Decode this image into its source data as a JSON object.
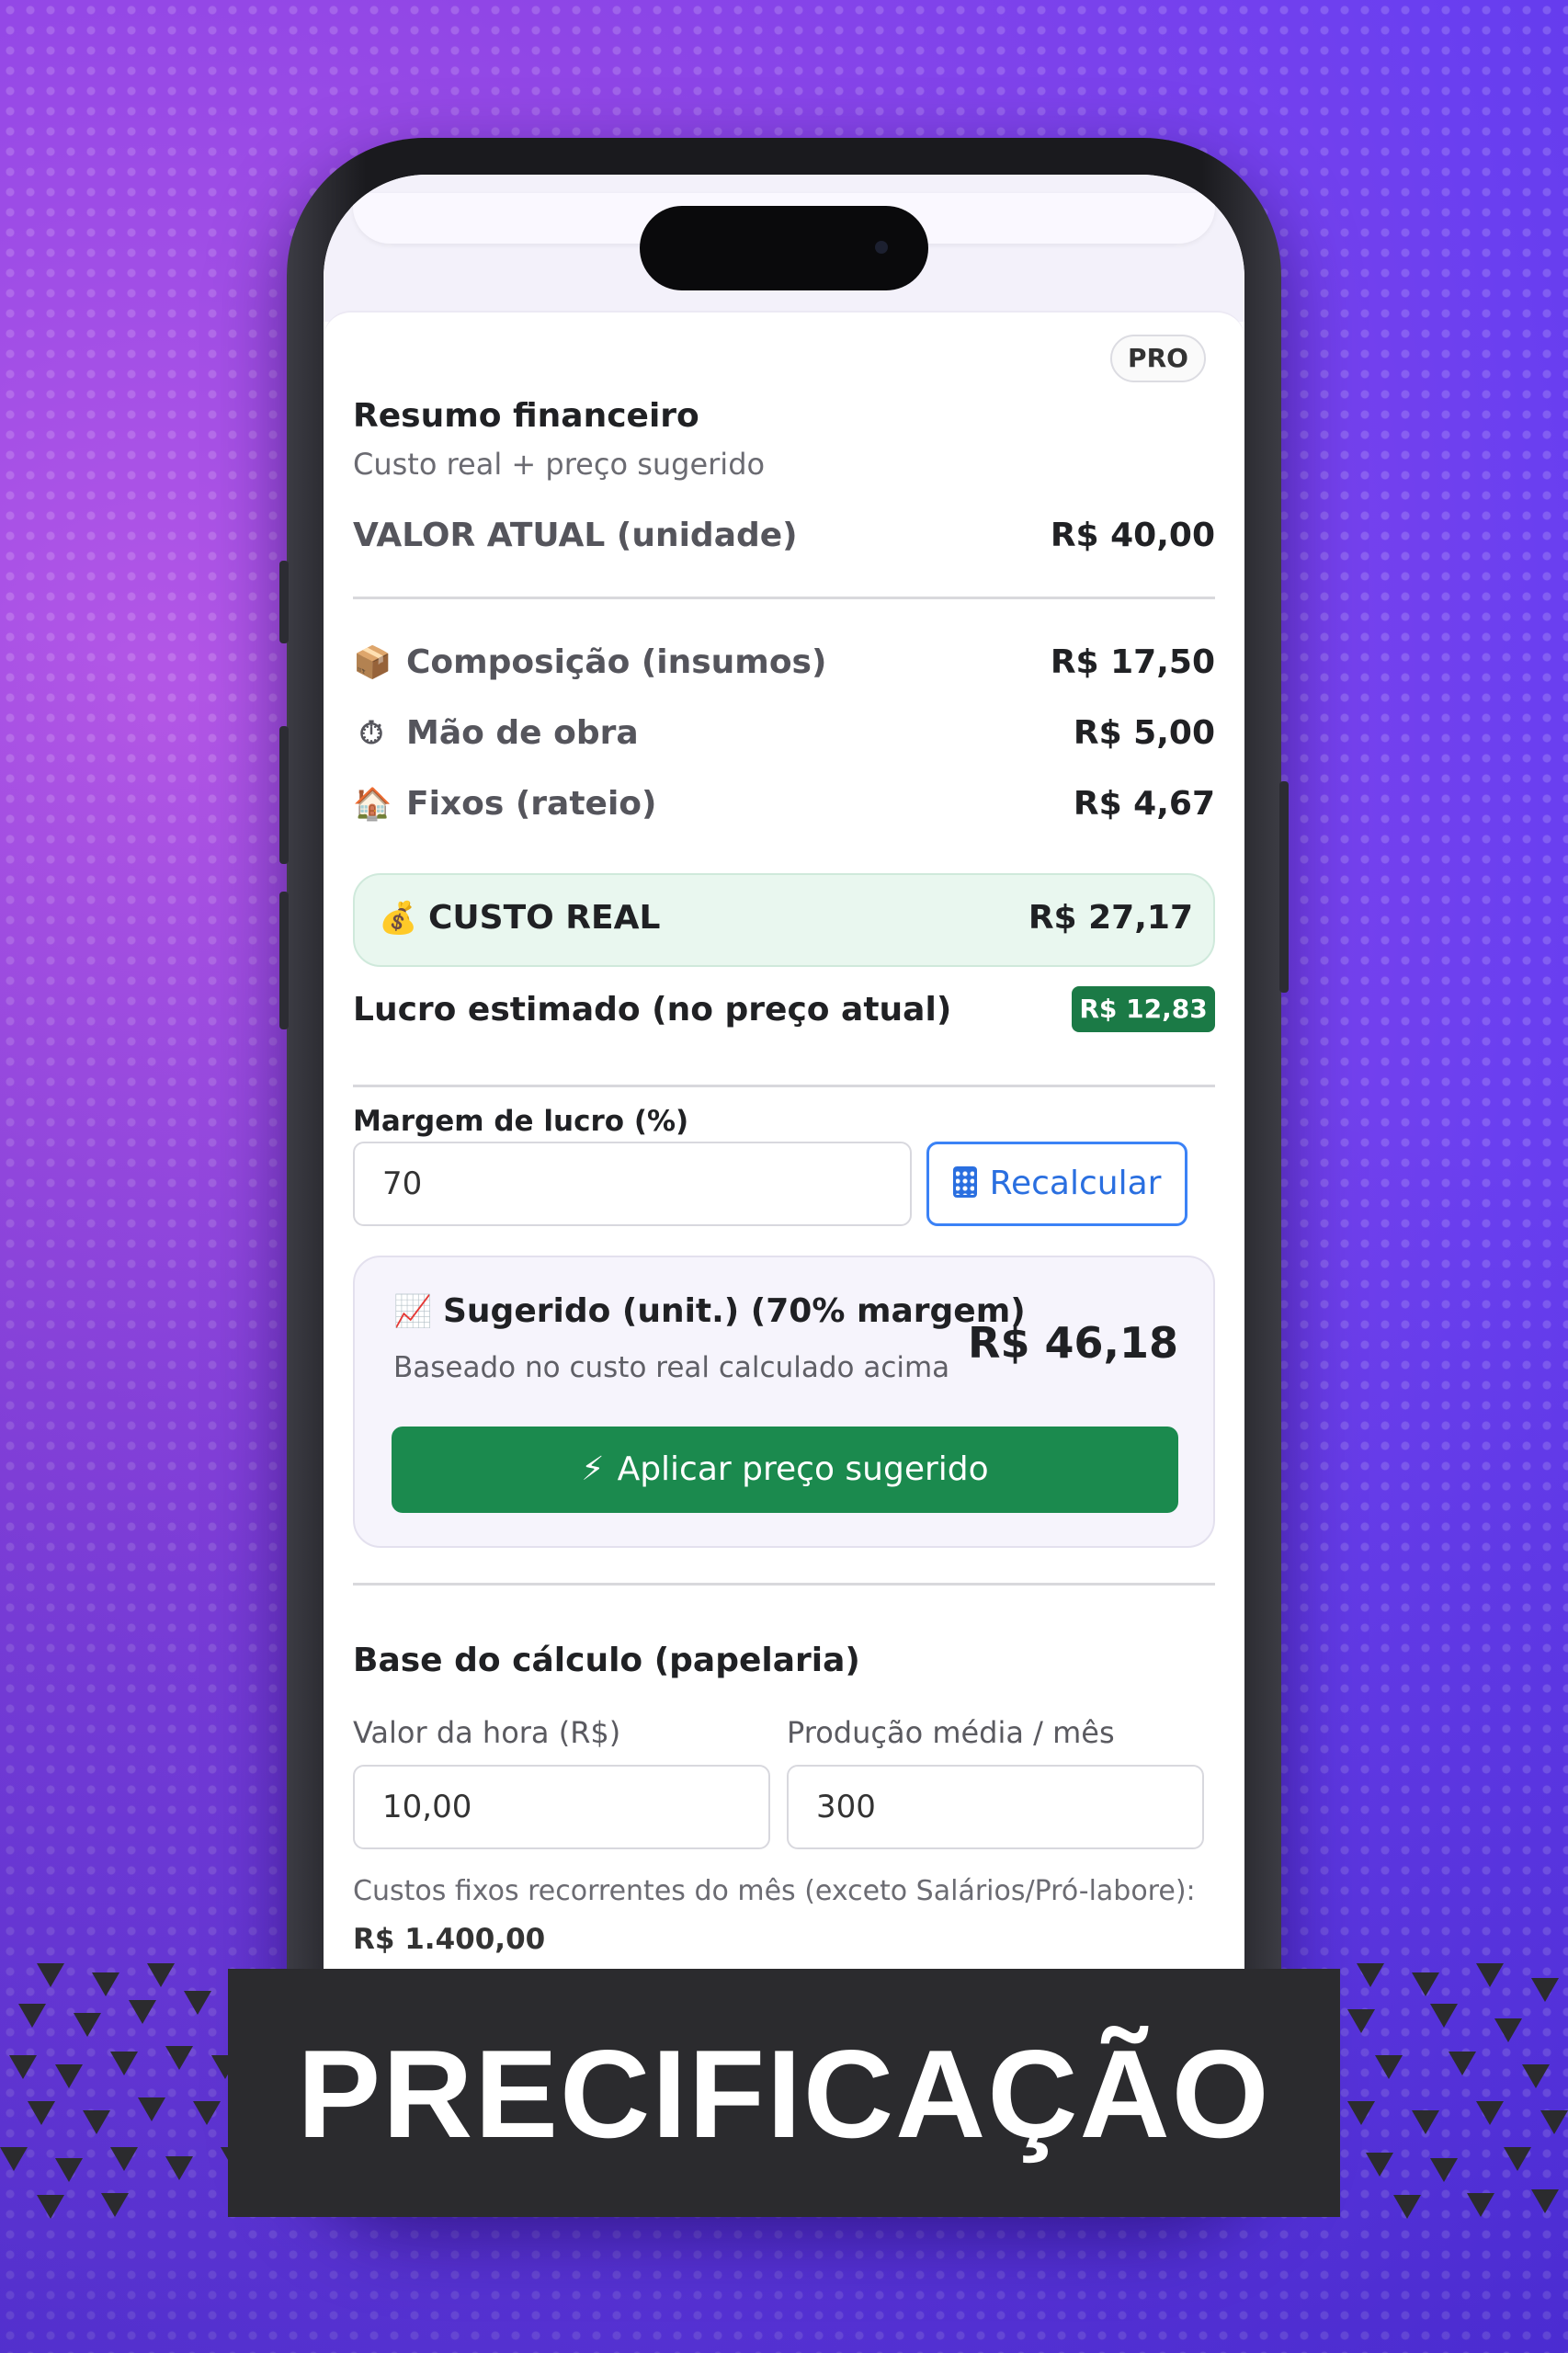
{
  "summary": {
    "title": "Resumo financeiro",
    "subtitle": "Custo real + preço sugerido",
    "badge": "PRO",
    "current_value_label": "VALOR ATUAL (unidade)",
    "current_value": "R$ 40,00"
  },
  "costs": [
    {
      "icon": "package-icon",
      "glyph": "📦",
      "label": "Composição (insumos)",
      "value": "R$ 17,50"
    },
    {
      "icon": "stopwatch-icon",
      "glyph": "⏱",
      "label": "Mão de obra",
      "value": "R$ 5,00"
    },
    {
      "icon": "house-icon",
      "glyph": "🏠",
      "label": "Fixos (rateio)",
      "value": "R$ 4,67"
    }
  ],
  "real_cost": {
    "icon": "money-bag-icon",
    "glyph": "💰",
    "label": "CUSTO REAL",
    "value": "R$ 27,17"
  },
  "profit": {
    "label": "Lucro estimado (no preço atual)",
    "value": "R$ 12,83",
    "badge_color": "#1b7a46"
  },
  "margin": {
    "label": "Margem de lucro (%)",
    "value": "70",
    "recalc_label": "Recalcular"
  },
  "suggested": {
    "icon": "chart-up-icon",
    "title": "Sugerido (unit.) (70% margem)",
    "subtitle": "Baseado no custo real calculado acima",
    "value": "R$ 46,18",
    "apply_label": "Aplicar preço sugerido",
    "apply_color": "#1b8a4e"
  },
  "base": {
    "title": "Base do cálculo (papelaria)",
    "hour_label": "Valor da hora (R$)",
    "hour_value": "10,00",
    "production_label": "Produção média / mês",
    "production_value": "300",
    "fixed_costs_text": "Custos fixos recorrentes do mês (exceto Salários/Pró-labore):",
    "fixed_costs_value": "R$ 1.400,00"
  },
  "banner": {
    "text": "PRECIFICAÇÃO"
  }
}
